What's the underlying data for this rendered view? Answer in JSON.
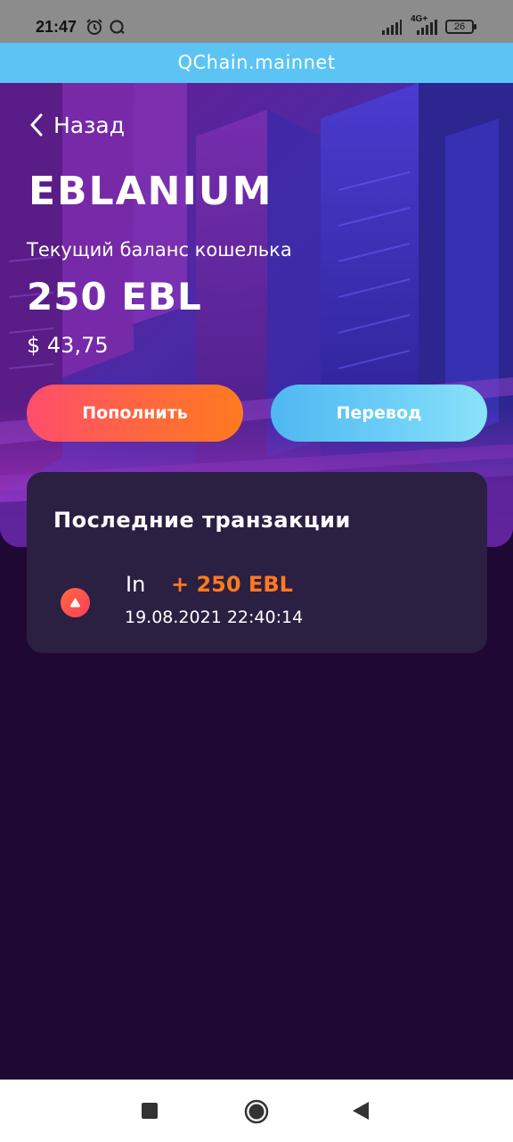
{
  "status_bar": {
    "time": "21:47",
    "network_label": "4G+",
    "battery": "26",
    "icons": [
      "alarm-icon",
      "q-icon",
      "signal-icon",
      "signal-icon",
      "battery-icon"
    ]
  },
  "network_banner": "QChain.mainnet",
  "header": {
    "back_label": "Назад",
    "token_name": "EBLANIUM",
    "balance_caption": "Текущий баланс кошелька",
    "balance_value": "250 EBL",
    "balance_usd": "$ 43,75"
  },
  "actions": {
    "topup_label": "Пополнить",
    "transfer_label": "Перевод"
  },
  "transactions": {
    "title": "Последние транзакции",
    "items": [
      {
        "direction": "In",
        "amount": "+ 250 EBL",
        "date": "19.08.2021 22:40:14",
        "icon": "arrow-up-icon"
      }
    ]
  },
  "colors": {
    "banner": "#5bc4f5",
    "background": "#1f0833",
    "card": "#2b1f42",
    "accent_orange": "#ff7a1f",
    "accent_blue": "#5bc4f5"
  },
  "nav": {
    "icons": [
      "recents-square-icon",
      "home-circle-icon",
      "back-triangle-icon"
    ]
  }
}
